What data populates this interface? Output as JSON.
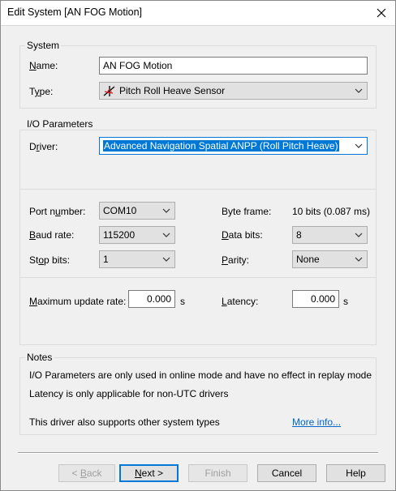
{
  "window": {
    "title": "Edit System [AN FOG Motion]"
  },
  "system": {
    "group_label": "System",
    "name_label": "Name:",
    "name_value": "AN FOG Motion",
    "type_label": "Type:",
    "type_value": "Pitch Roll Heave Sensor"
  },
  "io": {
    "group_label": "I/O Parameters",
    "driver_label": "Driver:",
    "driver_value": "Advanced Navigation Spatial ANPP (Roll Pitch Heave)",
    "port_label": "Port number:",
    "port_value": "COM10",
    "byte_frame_label": "Byte frame:",
    "byte_frame_value": "10 bits (0.087 ms)",
    "baud_label": "Baud rate:",
    "baud_value": "115200",
    "data_bits_label": "Data bits:",
    "data_bits_value": "8",
    "stop_bits_label": "Stop bits:",
    "stop_bits_value": "1",
    "parity_label": "Parity:",
    "parity_value": "None",
    "max_rate_label": "Maximum update rate:",
    "max_rate_value": "0.000",
    "max_rate_unit": "s",
    "latency_label": "Latency:",
    "latency_value": "0.000",
    "latency_unit": "s"
  },
  "notes": {
    "group_label": "Notes",
    "line1": "I/O Parameters are only used in online mode and have no effect in replay mode",
    "line2": "Latency is only applicable for non-UTC drivers",
    "line3": "This driver also supports other system types",
    "more_info": "More info..."
  },
  "buttons": {
    "back": "< Back",
    "next": "Next >",
    "finish": "Finish",
    "cancel": "Cancel",
    "help": "Help"
  },
  "icons": {
    "close": "close-icon",
    "chevron": "chevron-down-icon",
    "type": "pitch-roll-heave-icon"
  }
}
